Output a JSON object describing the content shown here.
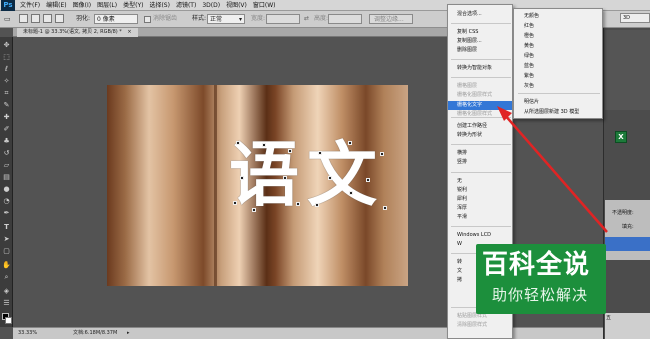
{
  "app": {
    "logo": "Ps"
  },
  "menubar": {
    "items": [
      "文件(F)",
      "编辑(E)",
      "图像(I)",
      "图层(L)",
      "类型(Y)",
      "选择(S)",
      "滤镜(T)",
      "3D(D)",
      "视图(V)",
      "窗口(W)"
    ]
  },
  "options": {
    "feather_label": "羽化:",
    "feather_value": "0 像素",
    "antialias_label": "消除锯齿",
    "style_label": "样式:",
    "style_value": "正常",
    "width_label": "宽度:",
    "height_label": "高度:",
    "refine_edge": "调整边缘...",
    "workspace": "3D"
  },
  "document": {
    "tab_title": "未标题-1 @ 33.3%(语文, 拷贝 2, RGB/8) *",
    "close": "×"
  },
  "canvas": {
    "text": [
      "语",
      "文"
    ]
  },
  "status": {
    "zoom": "33.33%",
    "doc_info": "文档:6.18M/8.37M"
  },
  "context_menu": {
    "items": [
      {
        "label": "混合选项...",
        "disabled": false,
        "highlight": false
      },
      {
        "label": "复制 CSS",
        "disabled": false,
        "highlight": false
      },
      {
        "label": "复制图层...",
        "disabled": false,
        "highlight": false
      },
      {
        "label": "删除图层",
        "disabled": false,
        "highlight": false
      },
      {
        "label": "转换为智能对象",
        "disabled": false,
        "highlight": false
      },
      {
        "label": "栅格图层",
        "disabled": true,
        "highlight": false
      },
      {
        "label": "栅格化图层样式",
        "disabled": true,
        "highlight": false
      },
      {
        "label": "栅格化文字",
        "disabled": false,
        "highlight": true
      },
      {
        "label": "栅格化图层样式",
        "disabled": true,
        "highlight": false
      },
      {
        "label": "创建工作路径",
        "disabled": false,
        "highlight": false
      },
      {
        "label": "转换为形状",
        "disabled": false,
        "highlight": false
      },
      {
        "label": "横排",
        "disabled": false,
        "highlight": false
      },
      {
        "label": "竖排",
        "disabled": false,
        "highlight": false
      },
      {
        "label": "无",
        "disabled": false,
        "highlight": false
      },
      {
        "label": "锐利",
        "disabled": false,
        "highlight": false
      },
      {
        "label": "犀利",
        "disabled": false,
        "highlight": false
      },
      {
        "label": "浑厚",
        "disabled": false,
        "highlight": false
      },
      {
        "label": "平滑",
        "disabled": false,
        "highlight": false
      },
      {
        "label": "Windows LCD",
        "disabled": false,
        "highlight": false
      },
      {
        "label": "W",
        "disabled": false,
        "highlight": false
      },
      {
        "label": "转",
        "disabled": false,
        "highlight": false
      },
      {
        "label": "文",
        "disabled": false,
        "highlight": false
      },
      {
        "label": "拷",
        "disabled": false,
        "highlight": false
      },
      {
        "label": "粘贴图层样式",
        "disabled": true,
        "highlight": false
      },
      {
        "label": "清除图层样式",
        "disabled": true,
        "highlight": false
      }
    ]
  },
  "submenu": {
    "items": [
      "无颜色",
      "红色",
      "橙色",
      "黄色",
      "绿色",
      "蓝色",
      "紫色",
      "灰色",
      "明信片",
      "从所选图层新建 3D 模型"
    ]
  },
  "right_panel": {
    "search": "3D",
    "opacity_label": "不透明度:",
    "fill_label": "填充:",
    "page_label": "五"
  },
  "watermark": {
    "title": "百科全说",
    "subtitle": "助你轻松解决"
  },
  "colors": {
    "highlight": "#3377d6",
    "arrow": "#e02424",
    "watermark_bg": "#1c8f3c"
  }
}
